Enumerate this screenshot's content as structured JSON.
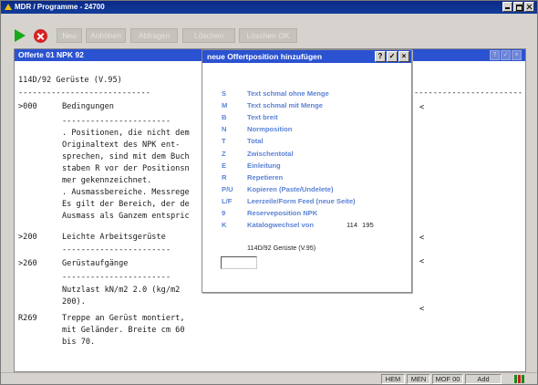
{
  "window": {
    "title": "MDR / Programme - 24700"
  },
  "toolbar": {
    "buttons": [
      {
        "label": "Neu"
      },
      {
        "label": "Anhöhen"
      },
      {
        "label": "Abfragen"
      },
      {
        "label": "Löschen"
      },
      {
        "label": "Löschen OK"
      }
    ]
  },
  "panel": {
    "title": "Offerte 01 NPK 92",
    "heading": "114D/92 Gerüste (V.95)",
    "separator_top": "----------------------------",
    "rows": [
      {
        "code": ">000",
        "text": "Bedingungen"
      },
      {
        "code": "",
        "text": "-----------------------"
      },
      {
        "code": "",
        "text": ". Positionen, die nicht dem"
      },
      {
        "code": "",
        "text": "Originaltext des NPK ent-"
      },
      {
        "code": "",
        "text": "sprechen, sind mit dem Buch"
      },
      {
        "code": "",
        "text": "staben R vor der Positionsn"
      },
      {
        "code": "",
        "text": "mer gekennzeichnet."
      },
      {
        "code": "",
        "text": ". Ausmassbereiche. Messrege"
      },
      {
        "code": "",
        "text": "Es gilt der Bereich, der de"
      },
      {
        "code": "",
        "text": "Ausmass als Ganzem entspric"
      },
      {
        "code": ">200",
        "text": "Leichte Arbeitsgerüste"
      },
      {
        "code": "",
        "text": "-----------------------"
      },
      {
        "code": ">260",
        "text": "Gerüstaufgänge"
      },
      {
        "code": "",
        "text": "-----------------------"
      },
      {
        "code": "",
        "text": "Nutzlast kN/m2 2.0 (kg/m2"
      },
      {
        "code": "",
        "text": "200)."
      },
      {
        "code": "R269",
        "text": "Treppe an Gerüst montiert,"
      },
      {
        "code": "",
        "text": "mit Geländer. Breite cm 60"
      },
      {
        "code": "",
        "text": "bis 70."
      }
    ],
    "right_separator": "-----------------------",
    "right_marks": [
      "<",
      "<",
      "<",
      "<"
    ]
  },
  "dialog": {
    "title": "neue Offertposition hinzufügen",
    "buttons": {
      "help": "?",
      "ok": "✓",
      "close": "×"
    },
    "options": [
      {
        "key": "S",
        "label": "Text schmal ohne Menge"
      },
      {
        "key": "M",
        "label": "Text schmal mit Menge"
      },
      {
        "key": "B",
        "label": "Text breit"
      },
      {
        "key": "N",
        "label": "Normposition"
      },
      {
        "key": "T",
        "label": "Total"
      },
      {
        "key": "Z",
        "label": "Zwischentotal"
      },
      {
        "key": "E",
        "label": "Einleitung"
      },
      {
        "key": "R",
        "label": "Repetieren"
      },
      {
        "key": "P/U",
        "label": "Kopieren (Paste/Undelete)"
      },
      {
        "key": "L/F",
        "label": "Leerzeile/Form Feed (neue Seite)"
      },
      {
        "key": "9",
        "label": "Reserveposition NPK"
      },
      {
        "key": "K",
        "label": "Katalogwechsel von",
        "value1": "114",
        "value2": "195"
      }
    ],
    "info": "114D/92 Gerüste (V.95)",
    "input_value": ""
  },
  "statusbar": {
    "cells": [
      "HEM",
      "MEN",
      "MOF 00",
      "Add"
    ]
  }
}
